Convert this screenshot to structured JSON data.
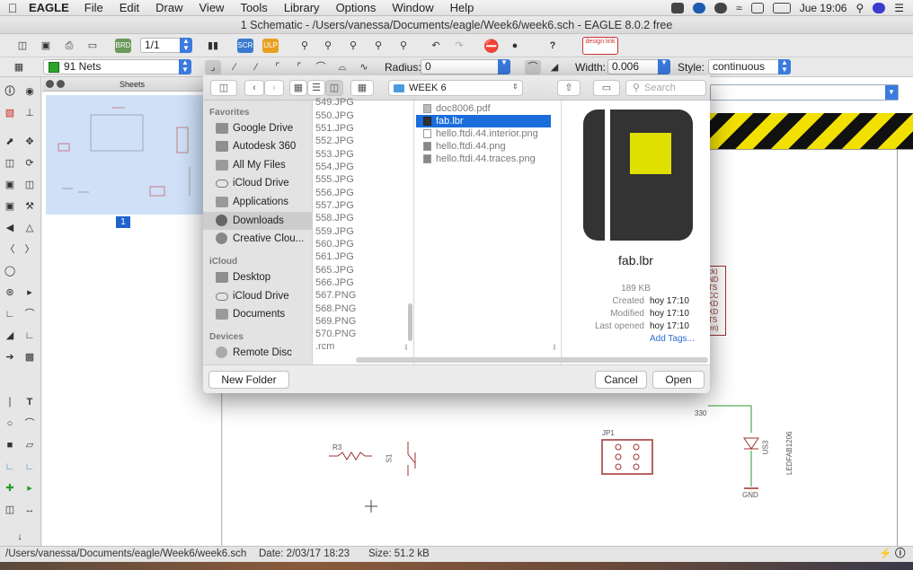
{
  "menubar": {
    "app_name": "EAGLE",
    "items": [
      "File",
      "Edit",
      "Draw",
      "View",
      "Tools",
      "Library",
      "Options",
      "Window",
      "Help"
    ],
    "clock": "Jue 19:06"
  },
  "window": {
    "title": "1 Schematic - /Users/vanessa/Documents/eagle/Week6/week6.sch - EAGLE 8.0.2 free"
  },
  "toolbar1": {
    "sheet_select": "1/1",
    "badge": "design link"
  },
  "toolbar2": {
    "net_class": "91 Nets",
    "radius_label": "Radius:",
    "radius_value": "0",
    "width_label": "Width:",
    "width_value": "0.006",
    "style_label": "Style:",
    "style_value": "continuous"
  },
  "sheets_panel": {
    "title": "Sheets",
    "sheet_number": "1"
  },
  "status_bar": {
    "path": "/Users/vanessa/Documents/eagle/Week6/week6.sch",
    "date": "Date: 2/03/17 18:23",
    "size": "Size: 51.2 kB"
  },
  "canvas": {
    "r3": "R3",
    "s1": "S1",
    "jp1": "JP1",
    "val330": "330",
    "gnd": "GND",
    "us3": "US3",
    "led": "LEDFAB1206",
    "pins": [
      "ck)",
      "ND",
      "TS",
      "CC",
      "XD",
      "XD",
      "TS",
      "en)"
    ]
  },
  "dialog": {
    "location": "WEEK 6",
    "search_placeholder": "Search",
    "sidebar": {
      "favorites_header": "Favorites",
      "favorites": [
        "Google Drive",
        "Autodesk 360",
        "All My Files",
        "iCloud Drive",
        "Applications",
        "Downloads",
        "Creative Clou..."
      ],
      "icloud_header": "iCloud",
      "icloud": [
        "Desktop",
        "iCloud Drive",
        "Documents"
      ],
      "devices_header": "Devices",
      "devices": [
        "Remote Disc"
      ]
    },
    "column1": [
      "549.JPG",
      "550.JPG",
      "551.JPG",
      "552.JPG",
      "553.JPG",
      "554.JPG",
      "555.JPG",
      "556.JPG",
      "557.JPG",
      "558.JPG",
      "559.JPG",
      "560.JPG",
      "561.JPG",
      "565.JPG",
      "566.JPG",
      "567.PNG",
      "568.PNG",
      "569.PNG",
      "570.PNG",
      ".rcm"
    ],
    "column2": [
      "doc8006.pdf",
      "fab.lbr",
      "hello.ftdi.44.interior.png",
      "hello.ftdi.44.png",
      "hello.ftdi.44.traces.png"
    ],
    "preview": {
      "name": "fab.lbr",
      "size": "189 KB",
      "created_label": "Created",
      "created_value": "hoy 17:10",
      "modified_label": "Modified",
      "modified_value": "hoy 17:10",
      "opened_label": "Last opened",
      "opened_value": "hoy 17:10",
      "add_tags": "Add Tags..."
    },
    "new_folder": "New Folder",
    "cancel": "Cancel",
    "open": "Open"
  }
}
